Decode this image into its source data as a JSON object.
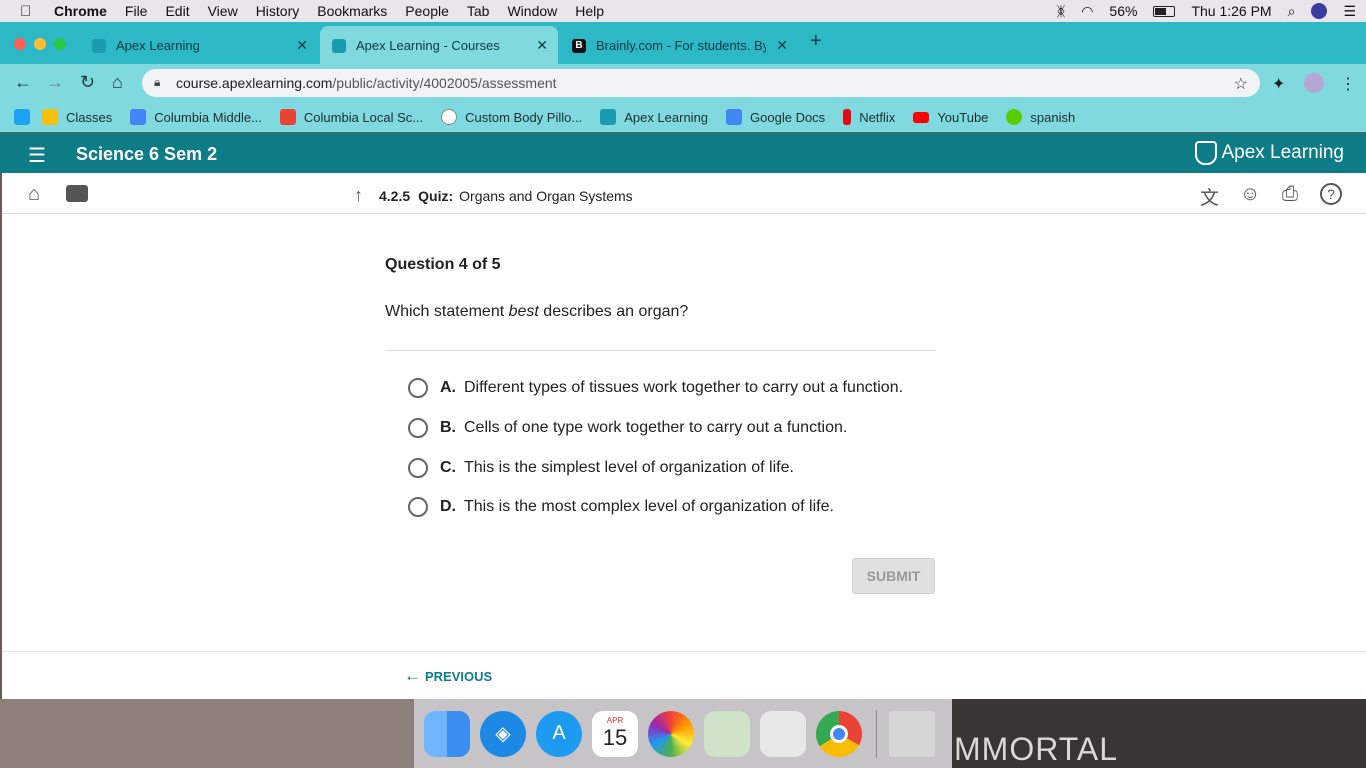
{
  "menubar": {
    "items": [
      "Chrome",
      "File",
      "Edit",
      "View",
      "History",
      "Bookmarks",
      "People",
      "Tab",
      "Window",
      "Help"
    ],
    "battery": "56%",
    "clock": "Thu 1:26 PM"
  },
  "tabs": [
    {
      "title": "Apex Learning"
    },
    {
      "title": "Apex Learning - Courses"
    },
    {
      "title": "Brainly.com - For students. By"
    }
  ],
  "address": {
    "domain": "course.apexlearning.com",
    "path": "/public/activity/4002005/assessment"
  },
  "bookmarks": [
    {
      "label": "Classes",
      "color": "#f4c20d"
    },
    {
      "label": "Columbia Middle...",
      "color": "#4285f4"
    },
    {
      "label": "Columbia Local Sc...",
      "color": "#ea4335"
    },
    {
      "label": "Custom Body Pillo...",
      "color": "#888888"
    },
    {
      "label": "Apex Learning",
      "color": "#1a9bb0"
    },
    {
      "label": "Google Docs",
      "color": "#4285f4"
    },
    {
      "label": "Netflix",
      "color": "#e50914"
    },
    {
      "label": "YouTube",
      "color": "#ff0000"
    },
    {
      "label": "spanish",
      "color": "#58cc02"
    }
  ],
  "apex": {
    "course_title": "Science 6 Sem 2",
    "logo_text": "Apex Learning",
    "activity_number": "4.2.5",
    "activity_kind": "Quiz:",
    "activity_title": "Organs and Organ Systems"
  },
  "question": {
    "header": "Question 4 of 5",
    "text_before": "Which statement ",
    "text_emph": "best",
    "text_after": " describes an organ?",
    "options": [
      {
        "letter": "A.",
        "text": "Different types of tissues work together to carry out a function."
      },
      {
        "letter": "B.",
        "text": "Cells of one type work together to carry out a function."
      },
      {
        "letter": "C.",
        "text": "This is the simplest level of organization of life."
      },
      {
        "letter": "D.",
        "text": "This is the most complex level of organization of life."
      }
    ],
    "submit_label": "SUBMIT",
    "previous_label": "PREVIOUS"
  },
  "dock": {
    "calendar_month": "APR",
    "calendar_day": "15"
  },
  "wallpaper_text": "MMORTAL",
  "colors": {
    "tab_strip": "#2cb9c5",
    "toolbar": "#7fd9df",
    "apex_header": "#0e7c87"
  }
}
